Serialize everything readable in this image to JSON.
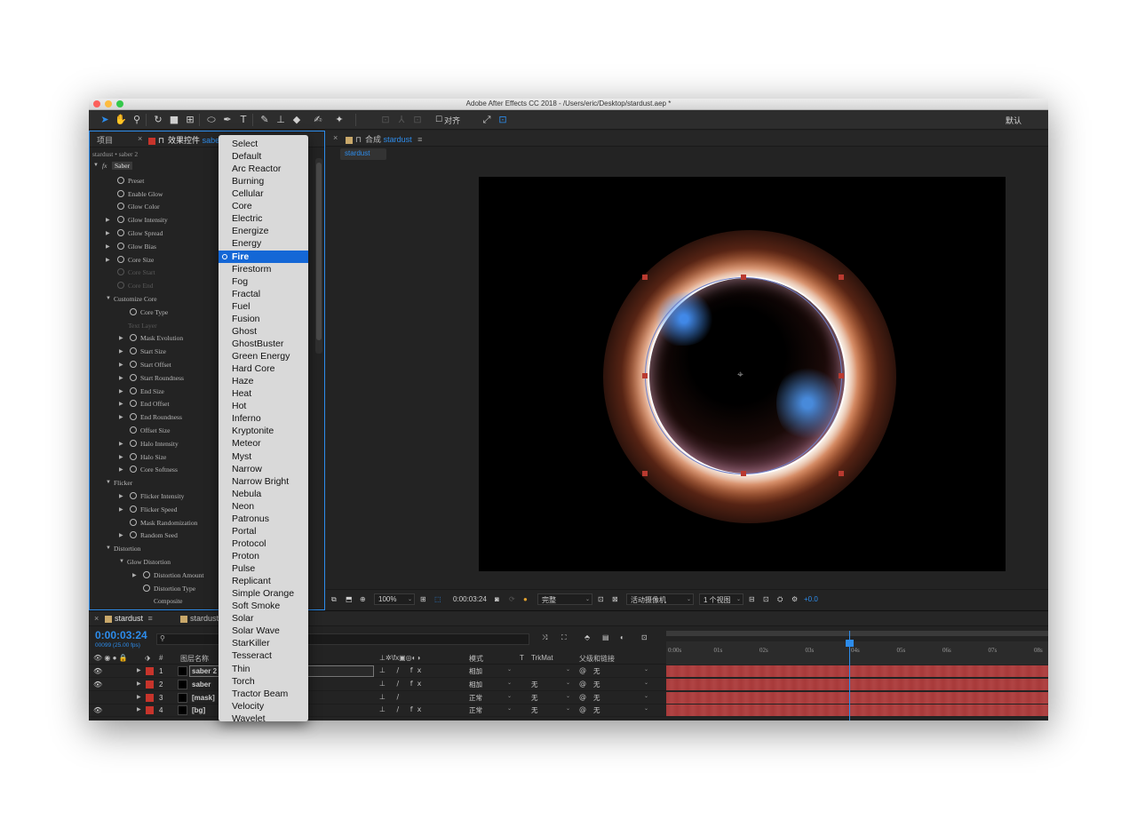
{
  "window": {
    "title": "Adobe After Effects CC 2018 - /Users/eric/Desktop/stardust.aep *",
    "workspace": "默认",
    "align_label": "对齐"
  },
  "project_tab": "项目",
  "effects_panel": {
    "tab_label": "效果控件",
    "tab_layer": "saber",
    "breadcrumb": "stardust • saber 2",
    "effect_name": "Saber",
    "rows": [
      {
        "label": "Preset",
        "indent": 0,
        "expand": false,
        "enabled": true
      },
      {
        "label": "Enable Glow",
        "indent": 0,
        "expand": false,
        "enabled": true
      },
      {
        "label": "Glow Color",
        "indent": 0,
        "expand": false,
        "enabled": true
      },
      {
        "label": "Glow Intensity",
        "indent": 0,
        "expand": true,
        "enabled": true
      },
      {
        "label": "Glow Spread",
        "indent": 0,
        "expand": true,
        "enabled": true
      },
      {
        "label": "Glow Bias",
        "indent": 0,
        "expand": true,
        "enabled": true
      },
      {
        "label": "Core Size",
        "indent": 0,
        "expand": true,
        "enabled": true
      },
      {
        "label": "Core Start",
        "indent": 0,
        "expand": false,
        "enabled": false
      },
      {
        "label": "Core End",
        "indent": 0,
        "expand": false,
        "enabled": false
      }
    ],
    "customize_core": "Customize Core",
    "core_type": "Core Type",
    "text_layer": "Text Layer",
    "core_rows": [
      "Mask Evolution",
      "Start Size",
      "Start Offset",
      "Start Roundness",
      "End Size",
      "End Offset",
      "End Roundness",
      "Offset Size",
      "Halo Intensity",
      "Halo Size",
      "Core Softness"
    ],
    "flicker": "Flicker",
    "flicker_rows": [
      "Flicker Intensity",
      "Flicker Speed",
      "Mask Randomization",
      "Random Seed"
    ],
    "distortion": "Distortion",
    "glow_distortion": "Glow Distortion",
    "distortion_rows": [
      "Distortion Amount",
      "Distortion Type",
      "Composite"
    ]
  },
  "preset_dropdown": {
    "items": [
      "Select",
      "Default",
      "Arc Reactor",
      "Burning",
      "Cellular",
      "Core",
      "Electric",
      "Energize",
      "Energy",
      "Fire",
      "Firestorm",
      "Fog",
      "Fractal",
      "Fuel",
      "Fusion",
      "Ghost",
      "GhostBuster",
      "Green Energy",
      "Hard Core",
      "Haze",
      "Heat",
      "Hot",
      "Inferno",
      "Kryptonite",
      "Meteor",
      "Myst",
      "Narrow",
      "Narrow Bright",
      "Nebula",
      "Neon",
      "Patronus",
      "Portal",
      "Protocol",
      "Proton",
      "Pulse",
      "Replicant",
      "Simple Orange",
      "Soft Smoke",
      "Solar",
      "Solar Wave",
      "StarKiller",
      "Tesseract",
      "Thin",
      "Torch",
      "Tractor Beam",
      "Velocity",
      "Wavelet"
    ],
    "selected": "Fire"
  },
  "comp_panel": {
    "tab_prefix": "合成",
    "comp_name": "stardust",
    "subtab": "stardust"
  },
  "viewer_bar": {
    "zoom": "100%",
    "timecode": "0:00:03:24",
    "resolution": "完整",
    "camera": "活动摄像机",
    "views": "1 个视图",
    "exposure": "+0.0"
  },
  "timeline": {
    "tab1": "stardust",
    "tab2": "stardust",
    "timecode": "0:00:03:24",
    "frames": "00099 (25.00 fps)",
    "col_layer_name": "图层名称",
    "col_mode": "模式",
    "col_t": "T",
    "col_trkmat": "TrkMat",
    "col_parent": "父级和链接",
    "ticks": [
      "0:00s",
      "01s",
      "02s",
      "03s",
      "04s",
      "05s",
      "06s",
      "07s",
      "08s"
    ],
    "layers": [
      {
        "num": "1",
        "name": "saber 2",
        "mode": "相加",
        "trkmat": "",
        "parent": "无",
        "visible": true
      },
      {
        "num": "2",
        "name": "saber",
        "mode": "相加",
        "trkmat": "无",
        "parent": "无",
        "visible": true
      },
      {
        "num": "3",
        "name": "[mask]",
        "mode": "正常",
        "trkmat": "无",
        "parent": "无",
        "visible": false
      },
      {
        "num": "4",
        "name": "[bg]",
        "mode": "正常",
        "trkmat": "无",
        "parent": "无",
        "visible": true
      }
    ]
  },
  "colors": {
    "accent": "#2d8ceb",
    "label_red": "#c7342b",
    "panel_bg": "#232323"
  }
}
